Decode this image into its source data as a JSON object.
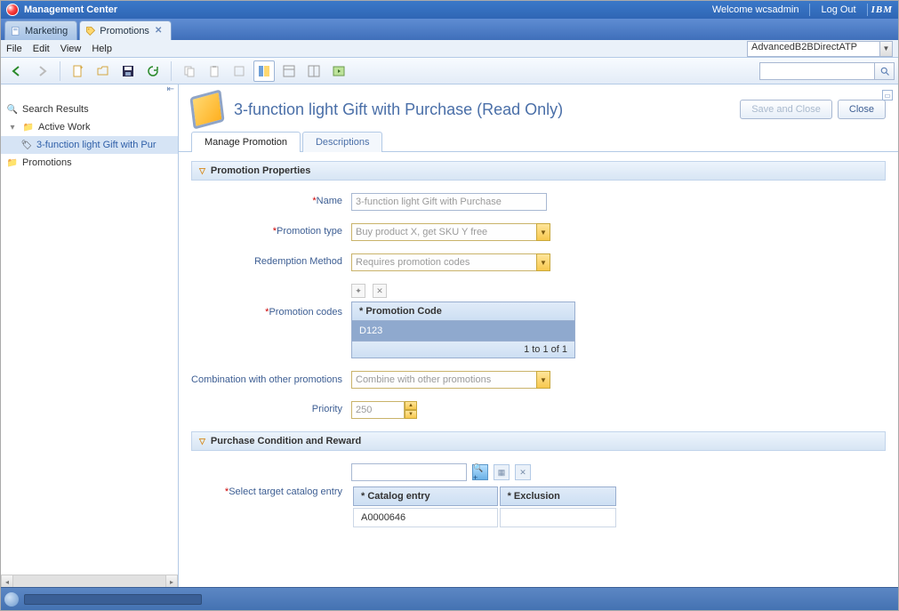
{
  "header": {
    "title": "Management Center",
    "welcome": "Welcome wcsadmin",
    "logout": "Log Out",
    "brand": "IBM"
  },
  "tabs": {
    "marketing": "Marketing",
    "promotions": "Promotions"
  },
  "menu": {
    "file": "File",
    "edit": "Edit",
    "view": "View",
    "help": "Help"
  },
  "store_selector": {
    "value": "AdvancedB2BDirectATP"
  },
  "sidebar": {
    "search_results": "Search Results",
    "active_work": "Active Work",
    "active_item": "3-function light Gift with Pur",
    "promotions": "Promotions"
  },
  "page": {
    "title": "3-function light Gift with Purchase (Read Only)",
    "save_close": "Save and Close",
    "close": "Close"
  },
  "inner_tabs": {
    "manage": "Manage Promotion",
    "descriptions": "Descriptions"
  },
  "sections": {
    "properties": "Promotion Properties",
    "purchase": "Purchase Condition and Reward"
  },
  "fields": {
    "name_label": "Name",
    "name_value": "3-function light Gift with Purchase",
    "type_label": "Promotion type",
    "type_value": "Buy product X, get SKU Y free",
    "redemption_label": "Redemption Method",
    "redemption_value": "Requires promotion codes",
    "codes_label": "Promotion codes",
    "codes_header": "* Promotion Code",
    "codes_row": "D123",
    "codes_footer": "1 to 1 of 1",
    "combo_label": "Combination with other promotions",
    "combo_value": "Combine with other promotions",
    "priority_label": "Priority",
    "priority_value": "250",
    "catalog_label": "Select target catalog entry",
    "catalog_col1": "* Catalog entry",
    "catalog_col2": "* Exclusion",
    "catalog_cell": "A0000646"
  },
  "search": {
    "placeholder": ""
  }
}
